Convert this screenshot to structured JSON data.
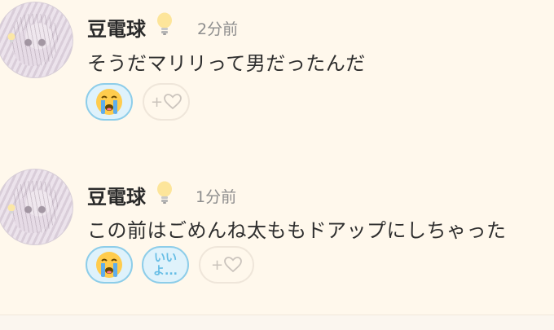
{
  "posts": [
    {
      "username": "豆電球",
      "time": "2分前",
      "message": "そうだマリリって男だったんだ",
      "reactions": [
        {
          "type": "emoji",
          "icon": "loudly-crying-face-icon"
        },
        {
          "type": "add",
          "label": "+",
          "icon": "heart-outline-icon"
        }
      ]
    },
    {
      "username": "豆電球",
      "time": "1分前",
      "message": "この前はごめんね太ももドアップにしちゃった",
      "reactions": [
        {
          "type": "emoji",
          "icon": "loudly-crying-face-icon"
        },
        {
          "type": "text",
          "label": "いい\nよ..."
        },
        {
          "type": "add",
          "label": "+",
          "icon": "heart-outline-icon"
        }
      ]
    }
  ],
  "colors": {
    "background": "#fff8ec",
    "reaction_selected_border": "#8dcde9",
    "reaction_selected_fill": "#dff2fb",
    "time_text": "#8d8d8d"
  }
}
